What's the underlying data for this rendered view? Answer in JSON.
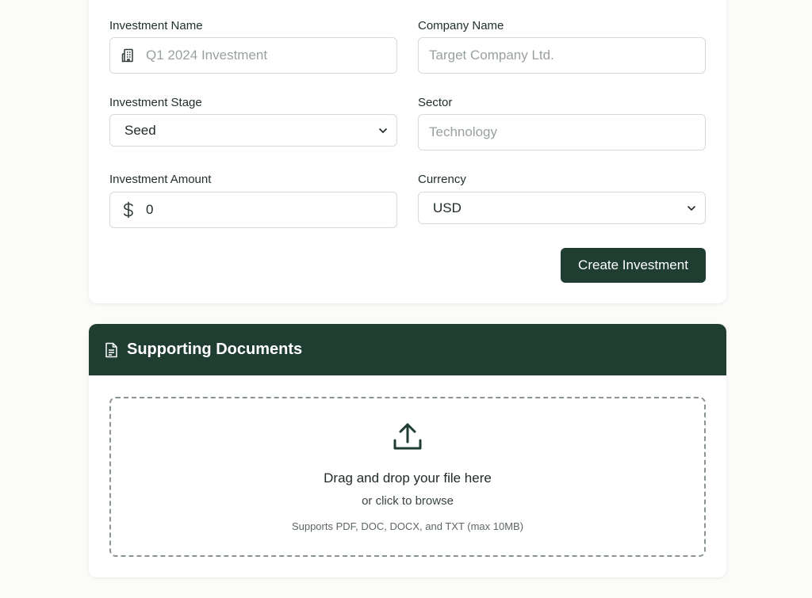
{
  "form": {
    "investment_name": {
      "label": "Investment Name",
      "placeholder": "Q1 2024 Investment"
    },
    "company_name": {
      "label": "Company Name",
      "placeholder": "Target Company Ltd."
    },
    "investment_stage": {
      "label": "Investment Stage",
      "value": "Seed"
    },
    "sector": {
      "label": "Sector",
      "placeholder": "Technology"
    },
    "investment_amount": {
      "label": "Investment Amount",
      "value": "0"
    },
    "currency": {
      "label": "Currency",
      "value": "USD"
    },
    "submit_label": "Create Investment"
  },
  "documents": {
    "title": "Supporting Documents",
    "drop_title": "Drag and drop your file here",
    "drop_sub": "or click to browse",
    "drop_note": "Supports PDF, DOC, DOCX, and TXT (max 10MB)"
  },
  "icons": {
    "name_field": "building-icon",
    "amount_field": "dollar-icon",
    "header": "document-icon",
    "upload": "upload-icon",
    "select": "chevron-down-icon"
  },
  "colors": {
    "primary": "#1f3d31",
    "background": "#fbfbf9",
    "border": "#d8dad7",
    "placeholder": "#9aa29d"
  }
}
